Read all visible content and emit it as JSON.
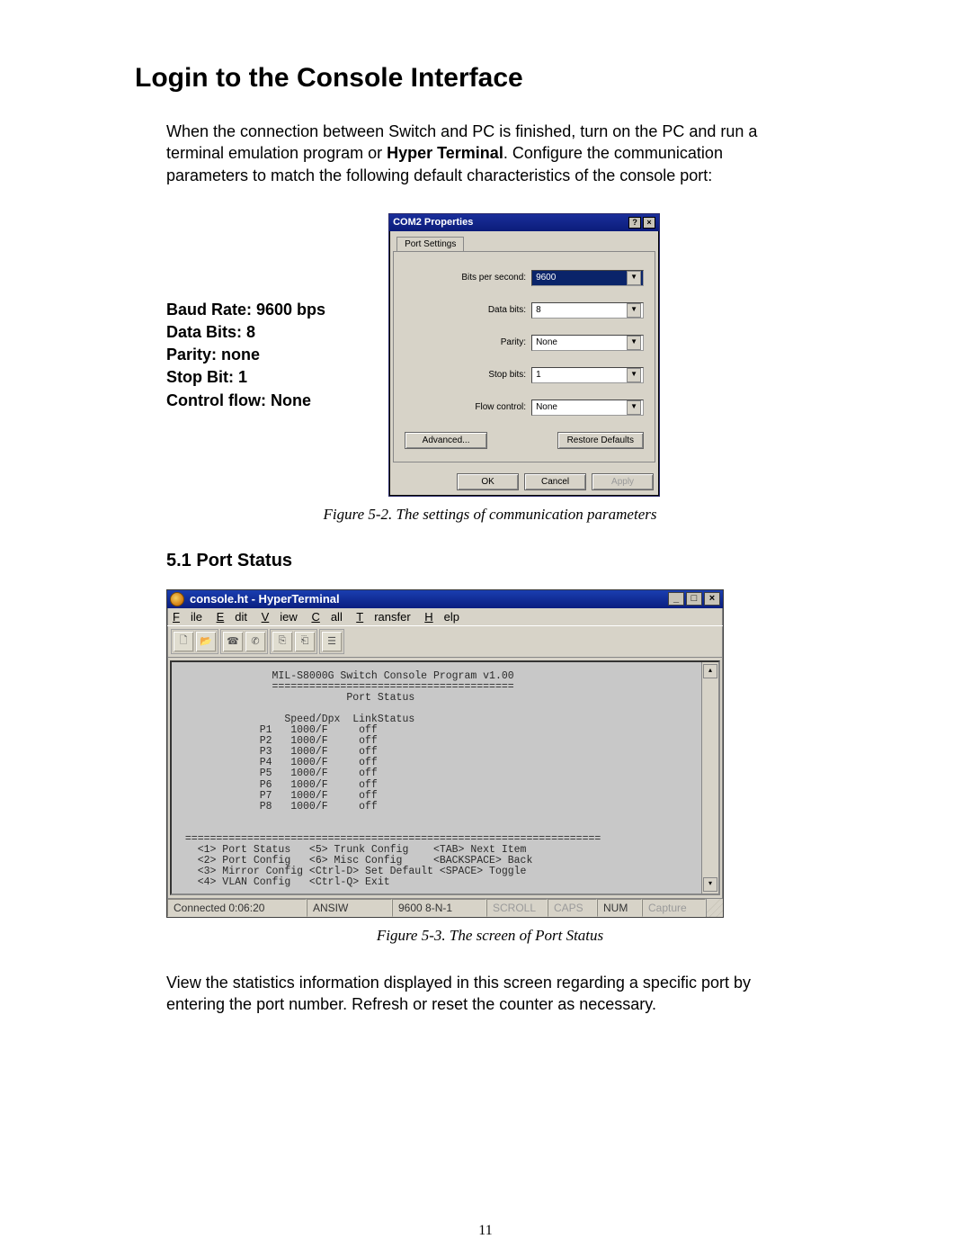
{
  "title": "Login to the Console Interface",
  "intro_pre": "When the connection between Switch and PC is finished, turn on the PC and run a terminal emulation program or ",
  "intro_bold": "Hyper Terminal",
  "intro_post": ".  Configure the communication parameters to match the following default characteristics of the console port:",
  "params": {
    "baud": "Baud Rate: 9600 bps",
    "databits": "Data Bits: 8",
    "parity": "Parity: none",
    "stopbit": "Stop Bit: 1",
    "flow": "Control flow: None"
  },
  "com_dialog": {
    "title": "COM2 Properties",
    "help_btn": "?",
    "close_btn": "×",
    "tab": "Port Settings",
    "fields": {
      "bps_label": "Bits per second:",
      "bps_value": "9600",
      "databits_label": "Data bits:",
      "databits_value": "8",
      "parity_label": "Parity:",
      "parity_value": "None",
      "stopbits_label": "Stop bits:",
      "stopbits_value": "1",
      "flow_label": "Flow control:",
      "flow_value": "None"
    },
    "advanced_btn": "Advanced...",
    "restore_btn": "Restore Defaults",
    "ok_btn": "OK",
    "cancel_btn": "Cancel",
    "apply_btn": "Apply"
  },
  "caption1": "Figure 5-2. The settings of communication parameters",
  "section_heading": "5.1 Port Status",
  "hyperterminal": {
    "title": "console.ht - HyperTerminal",
    "min_btn": "_",
    "max_btn": "□",
    "close_btn": "×",
    "menus": [
      "File",
      "Edit",
      "View",
      "Call",
      "Transfer",
      "Help"
    ],
    "toolbar_icons": [
      "new-doc-icon",
      "open-folder-icon",
      "phone-connect-icon",
      "phone-disconnect-icon",
      "send-icon",
      "receive-icon",
      "properties-icon"
    ],
    "terminal_header": "               MIL-S8000G Switch Console Program v1.00",
    "terminal_divider1": "               =======================================",
    "terminal_title": "                           Port Status",
    "terminal_cols": "                 Speed/Dpx  LinkStatus",
    "ports": [
      {
        "p": "P1",
        "sd": "1000/F",
        "ls": "off"
      },
      {
        "p": "P2",
        "sd": "1000/F",
        "ls": "off"
      },
      {
        "p": "P3",
        "sd": "1000/F",
        "ls": "off"
      },
      {
        "p": "P4",
        "sd": "1000/F",
        "ls": "off"
      },
      {
        "p": "P5",
        "sd": "1000/F",
        "ls": "off"
      },
      {
        "p": "P6",
        "sd": "1000/F",
        "ls": "off"
      },
      {
        "p": "P7",
        "sd": "1000/F",
        "ls": "off"
      },
      {
        "p": "P8",
        "sd": "1000/F",
        "ls": "off"
      }
    ],
    "terminal_divider2": " ===================================================================",
    "menu1": "   <1> Port Status   <5> Trunk Config    <TAB> Next Item",
    "menu2": "   <2> Port Config   <6> Misc Config     <BACKSPACE> Back",
    "menu3": "   <3> Mirror Config <Ctrl-D> Set Default <SPACE> Toggle",
    "menu4": "   <4> VLAN Config   <Ctrl-Q> Exit",
    "status": {
      "connected": "Connected 0:06:20",
      "emulation": "ANSIW",
      "settings": "9600 8-N-1",
      "scroll": "SCROLL",
      "caps": "CAPS",
      "num": "NUM",
      "capture": "Capture"
    }
  },
  "caption2": "Figure 5-3. The screen of Port Status",
  "closing": "View the statistics information displayed in this screen regarding a specific port by entering the port number. Refresh or reset the counter as necessary.",
  "page_number": "11"
}
